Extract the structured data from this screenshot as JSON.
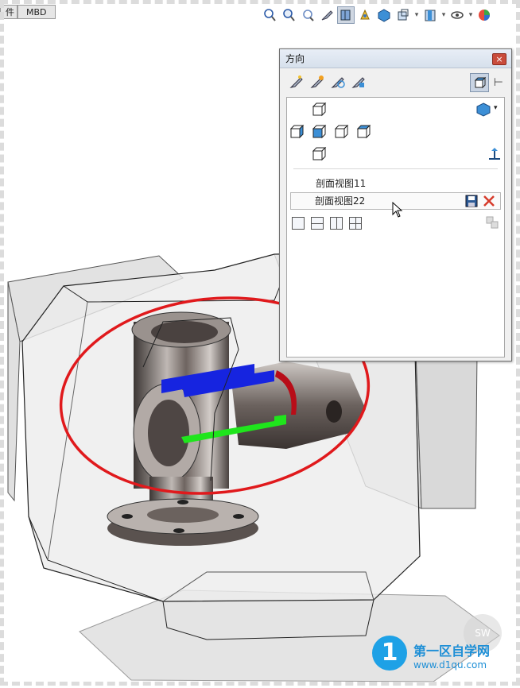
{
  "tabs": [
    {
      "label": "件"
    },
    {
      "label": "MBD"
    }
  ],
  "hud_icons": [
    "zoom-to-fit-icon",
    "zoom-area-icon",
    "previous-view-icon",
    "section-view-icon",
    "dynamic-annotation-icon",
    "display-style-icon",
    "hide-show-icon",
    "edit-appearance-icon",
    "apply-scene-icon",
    "view-settings-icon"
  ],
  "dialog": {
    "title": "方向",
    "close_glyph": "×",
    "toolbar_icons": [
      "new-view-icon",
      "update-standard-views-icon",
      "reset-standard-views-icon",
      "view-selector-icon"
    ],
    "pin_glyph": "⊢",
    "views": [
      {
        "label": "剖面视图11",
        "selected": false
      },
      {
        "label": "剖面视图22",
        "selected": true
      }
    ],
    "colors": {
      "accent": "#3c8fd6",
      "close": "#c94c3c",
      "delete": "#d63a2a"
    }
  },
  "annotations": {
    "ellipse_color": "#e0191c",
    "arrow_color": "#e0191c"
  },
  "watermark": {
    "site_name": "第一区自学网",
    "url": "www.d1qu.com",
    "logo_glyph": "1",
    "badge": "SW"
  }
}
